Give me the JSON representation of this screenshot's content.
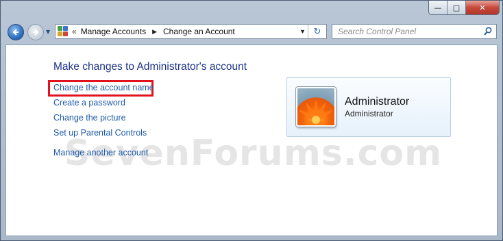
{
  "window": {
    "caption": {
      "minimize": "—",
      "maximize": "□",
      "close": "✕"
    }
  },
  "nav": {
    "back_icon": "back-arrow-icon",
    "forward_icon": "forward-arrow-icon",
    "history_icon": "chevron-down-icon"
  },
  "address": {
    "chevron": "«",
    "crumbs": [
      "Manage Accounts",
      "Change an Account"
    ],
    "separator": "▶",
    "dropdown": "▼",
    "refresh": "↻"
  },
  "search": {
    "placeholder": "Search Control Panel"
  },
  "main": {
    "title": "Make changes to Administrator's account",
    "links": [
      "Change the account name",
      "Create a password",
      "Change the picture",
      "Set up Parental Controls",
      "Manage another account"
    ]
  },
  "account": {
    "name": "Administrator",
    "type": "Administrator"
  },
  "watermark": "SevenForums.com",
  "colors": {
    "link": "#1e5aa8",
    "title": "#1e3287",
    "highlight": "#e0121e"
  }
}
